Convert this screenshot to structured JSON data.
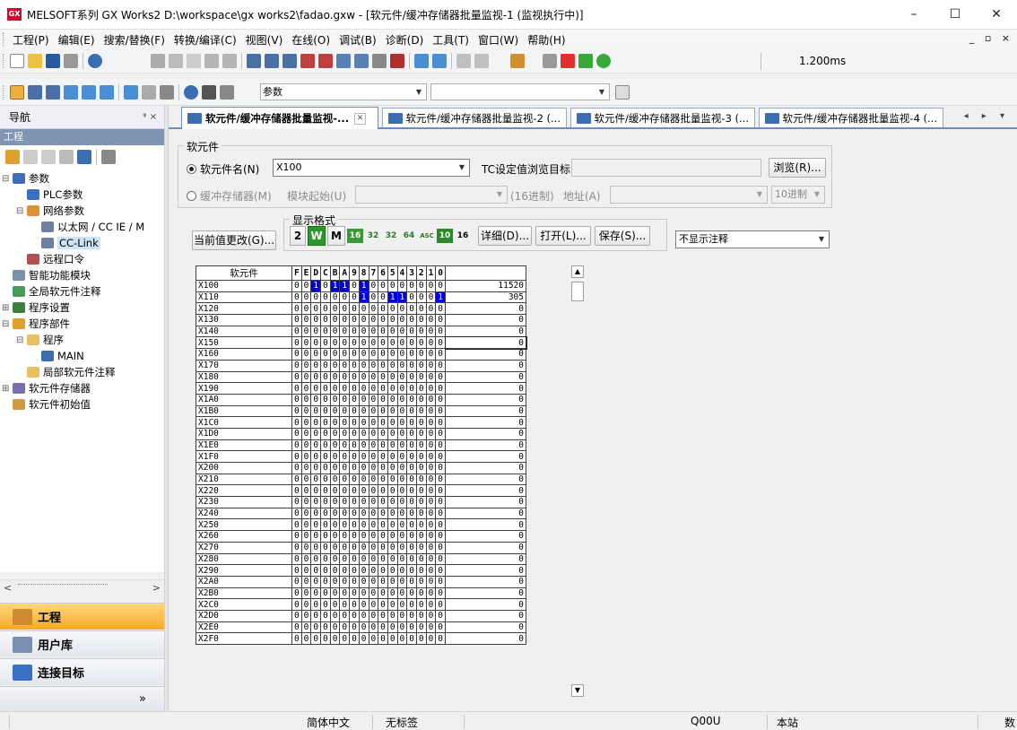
{
  "window": {
    "title": "MELSOFT系列 GX Works2 D:\\workspace\\gx works2\\fadao.gxw - [软元件/缓冲存储器批量监视-1 (监视执行中)]",
    "minimize": "–",
    "restore": "☐",
    "close": "✕"
  },
  "menu": {
    "items": [
      "工程(P)",
      "编辑(E)",
      "搜索/替换(F)",
      "转换/编译(C)",
      "视图(V)",
      "在线(O)",
      "调试(B)",
      "诊断(D)",
      "工具(T)",
      "窗口(W)",
      "帮助(H)"
    ],
    "mdi_controls": "_ ▫ ×"
  },
  "toolbar": {
    "scan_time": "1.200ms",
    "param_combo": "参数"
  },
  "nav": {
    "header": "导航",
    "pin": "ᵠ ×",
    "project_bar": "工程",
    "tree": [
      {
        "label": "参数",
        "indent": 0,
        "exp": "⊟",
        "color": "#3d6fb6"
      },
      {
        "label": "PLC参数",
        "indent": 1,
        "exp": "",
        "color": "#3a6fc6"
      },
      {
        "label": "网络参数",
        "indent": 1,
        "exp": "⊟",
        "color": "#e09030"
      },
      {
        "label": "以太网 / CC IE / M",
        "indent": 2,
        "exp": "",
        "color": "#6e7fa0"
      },
      {
        "label": "CC-Link",
        "indent": 2,
        "exp": "",
        "color": "#6e7fa0",
        "selected": true
      },
      {
        "label": "远程口令",
        "indent": 1,
        "exp": "",
        "color": "#b05050"
      },
      {
        "label": "智能功能模块",
        "indent": 0,
        "exp": "",
        "color": "#7a8fa8"
      },
      {
        "label": "全局软元件注释",
        "indent": 0,
        "exp": "",
        "color": "#4a9a5a"
      },
      {
        "label": "程序设置",
        "indent": 0,
        "exp": "⊞",
        "color": "#3d7f3d"
      },
      {
        "label": "程序部件",
        "indent": 0,
        "exp": "⊟",
        "color": "#e0a030"
      },
      {
        "label": "程序",
        "indent": 1,
        "exp": "⊟",
        "color": "#e8c060"
      },
      {
        "label": "MAIN",
        "indent": 2,
        "exp": "",
        "color": "#3b6db3"
      },
      {
        "label": "局部软元件注释",
        "indent": 1,
        "exp": "",
        "color": "#e8c060"
      },
      {
        "label": "软元件存储器",
        "indent": 0,
        "exp": "⊞",
        "color": "#7a6fa8"
      },
      {
        "label": "软元件初始值",
        "indent": 0,
        "exp": "",
        "color": "#d09a40"
      }
    ],
    "buttons": [
      {
        "label": "工程",
        "active": true,
        "color": "#d08a30"
      },
      {
        "label": "用户库",
        "active": false,
        "color": "#7a8fb0"
      },
      {
        "label": "连接目标",
        "active": false,
        "color": "#3a6fc6"
      }
    ],
    "expand": "»"
  },
  "tabs": [
    {
      "label": "软元件/缓冲存储器批量监视-...",
      "active": true,
      "close": "✕"
    },
    {
      "label": "软元件/缓冲存储器批量监视-2 (...",
      "active": false
    },
    {
      "label": "软元件/缓冲存储器批量监视-3 (...",
      "active": false
    },
    {
      "label": "软元件/缓冲存储器批量监视-4 (...",
      "active": false
    }
  ],
  "tab_scroll": "◂ ▸ ▾",
  "monitor": {
    "group_device": "软元件",
    "radio_device": "软元件名(N)",
    "device_value": "X100",
    "tc_label": "TC设定值浏览目标",
    "browse_btn": "浏览(R)...",
    "radio_buffer": "缓冲存储器(M)",
    "module_start": "模块起始(U)",
    "hex_label": "(16进制)",
    "address": "地址(A)",
    "dec_combo": "10进制",
    "group_format": "显示格式",
    "change_btn": "当前值更改(G)...",
    "fmt_2": "2",
    "fmt_w": "W",
    "fmt_m": "M",
    "fmt_16": "16",
    "fmt_32a": "32",
    "fmt_32b": "32",
    "fmt_64": "64",
    "fmt_asc": "ASC",
    "fmt_10": "10",
    "fmt_16b": "16",
    "detail_btn": "详细(D)...",
    "open_btn": "打开(L)...",
    "save_btn": "保存(S)...",
    "comment_combo": "不显示注释"
  },
  "grid": {
    "header_device": "软元件",
    "bit_headers": [
      "F",
      "E",
      "D",
      "C",
      "B",
      "A",
      "9",
      "8",
      "7",
      "6",
      "5",
      "4",
      "3",
      "2",
      "1",
      "0"
    ],
    "rows": [
      {
        "device": "X100",
        "bits": "0010110100000000",
        "value": "11520"
      },
      {
        "device": "X110",
        "bits": "0000000100110001",
        "value": "305"
      },
      {
        "device": "X120",
        "bits": "0000000000000000",
        "value": "0"
      },
      {
        "device": "X130",
        "bits": "0000000000000000",
        "value": "0"
      },
      {
        "device": "X140",
        "bits": "0000000000000000",
        "value": "0"
      },
      {
        "device": "X150",
        "bits": "0000000000000000",
        "value": "0"
      },
      {
        "device": "X160",
        "bits": "0000000000000000",
        "value": "0"
      },
      {
        "device": "X170",
        "bits": "0000000000000000",
        "value": "0"
      },
      {
        "device": "X180",
        "bits": "0000000000000000",
        "value": "0"
      },
      {
        "device": "X190",
        "bits": "0000000000000000",
        "value": "0"
      },
      {
        "device": "X1A0",
        "bits": "0000000000000000",
        "value": "0"
      },
      {
        "device": "X1B0",
        "bits": "0000000000000000",
        "value": "0"
      },
      {
        "device": "X1C0",
        "bits": "0000000000000000",
        "value": "0"
      },
      {
        "device": "X1D0",
        "bits": "0000000000000000",
        "value": "0"
      },
      {
        "device": "X1E0",
        "bits": "0000000000000000",
        "value": "0"
      },
      {
        "device": "X1F0",
        "bits": "0000000000000000",
        "value": "0"
      },
      {
        "device": "X200",
        "bits": "0000000000000000",
        "value": "0"
      },
      {
        "device": "X210",
        "bits": "0000000000000000",
        "value": "0"
      },
      {
        "device": "X220",
        "bits": "0000000000000000",
        "value": "0"
      },
      {
        "device": "X230",
        "bits": "0000000000000000",
        "value": "0"
      },
      {
        "device": "X240",
        "bits": "0000000000000000",
        "value": "0"
      },
      {
        "device": "X250",
        "bits": "0000000000000000",
        "value": "0"
      },
      {
        "device": "X260",
        "bits": "0000000000000000",
        "value": "0"
      },
      {
        "device": "X270",
        "bits": "0000000000000000",
        "value": "0"
      },
      {
        "device": "X280",
        "bits": "0000000000000000",
        "value": "0"
      },
      {
        "device": "X290",
        "bits": "0000000000000000",
        "value": "0"
      },
      {
        "device": "X2A0",
        "bits": "0000000000000000",
        "value": "0"
      },
      {
        "device": "X2B0",
        "bits": "0000000000000000",
        "value": "0"
      },
      {
        "device": "X2C0",
        "bits": "0000000000000000",
        "value": "0"
      },
      {
        "device": "X2D0",
        "bits": "0000000000000000",
        "value": "0"
      },
      {
        "device": "X2E0",
        "bits": "0000000000000000",
        "value": "0"
      },
      {
        "device": "X2F0",
        "bits": "0000000000000000",
        "value": "0"
      }
    ]
  },
  "status": {
    "language": "简体中文",
    "label": "无标签",
    "cpu": "Q00U",
    "station": "本站",
    "right": "数"
  },
  "colors": {
    "bit_on": "#0000e6",
    "active_tab_border": "#6a8cc7"
  }
}
